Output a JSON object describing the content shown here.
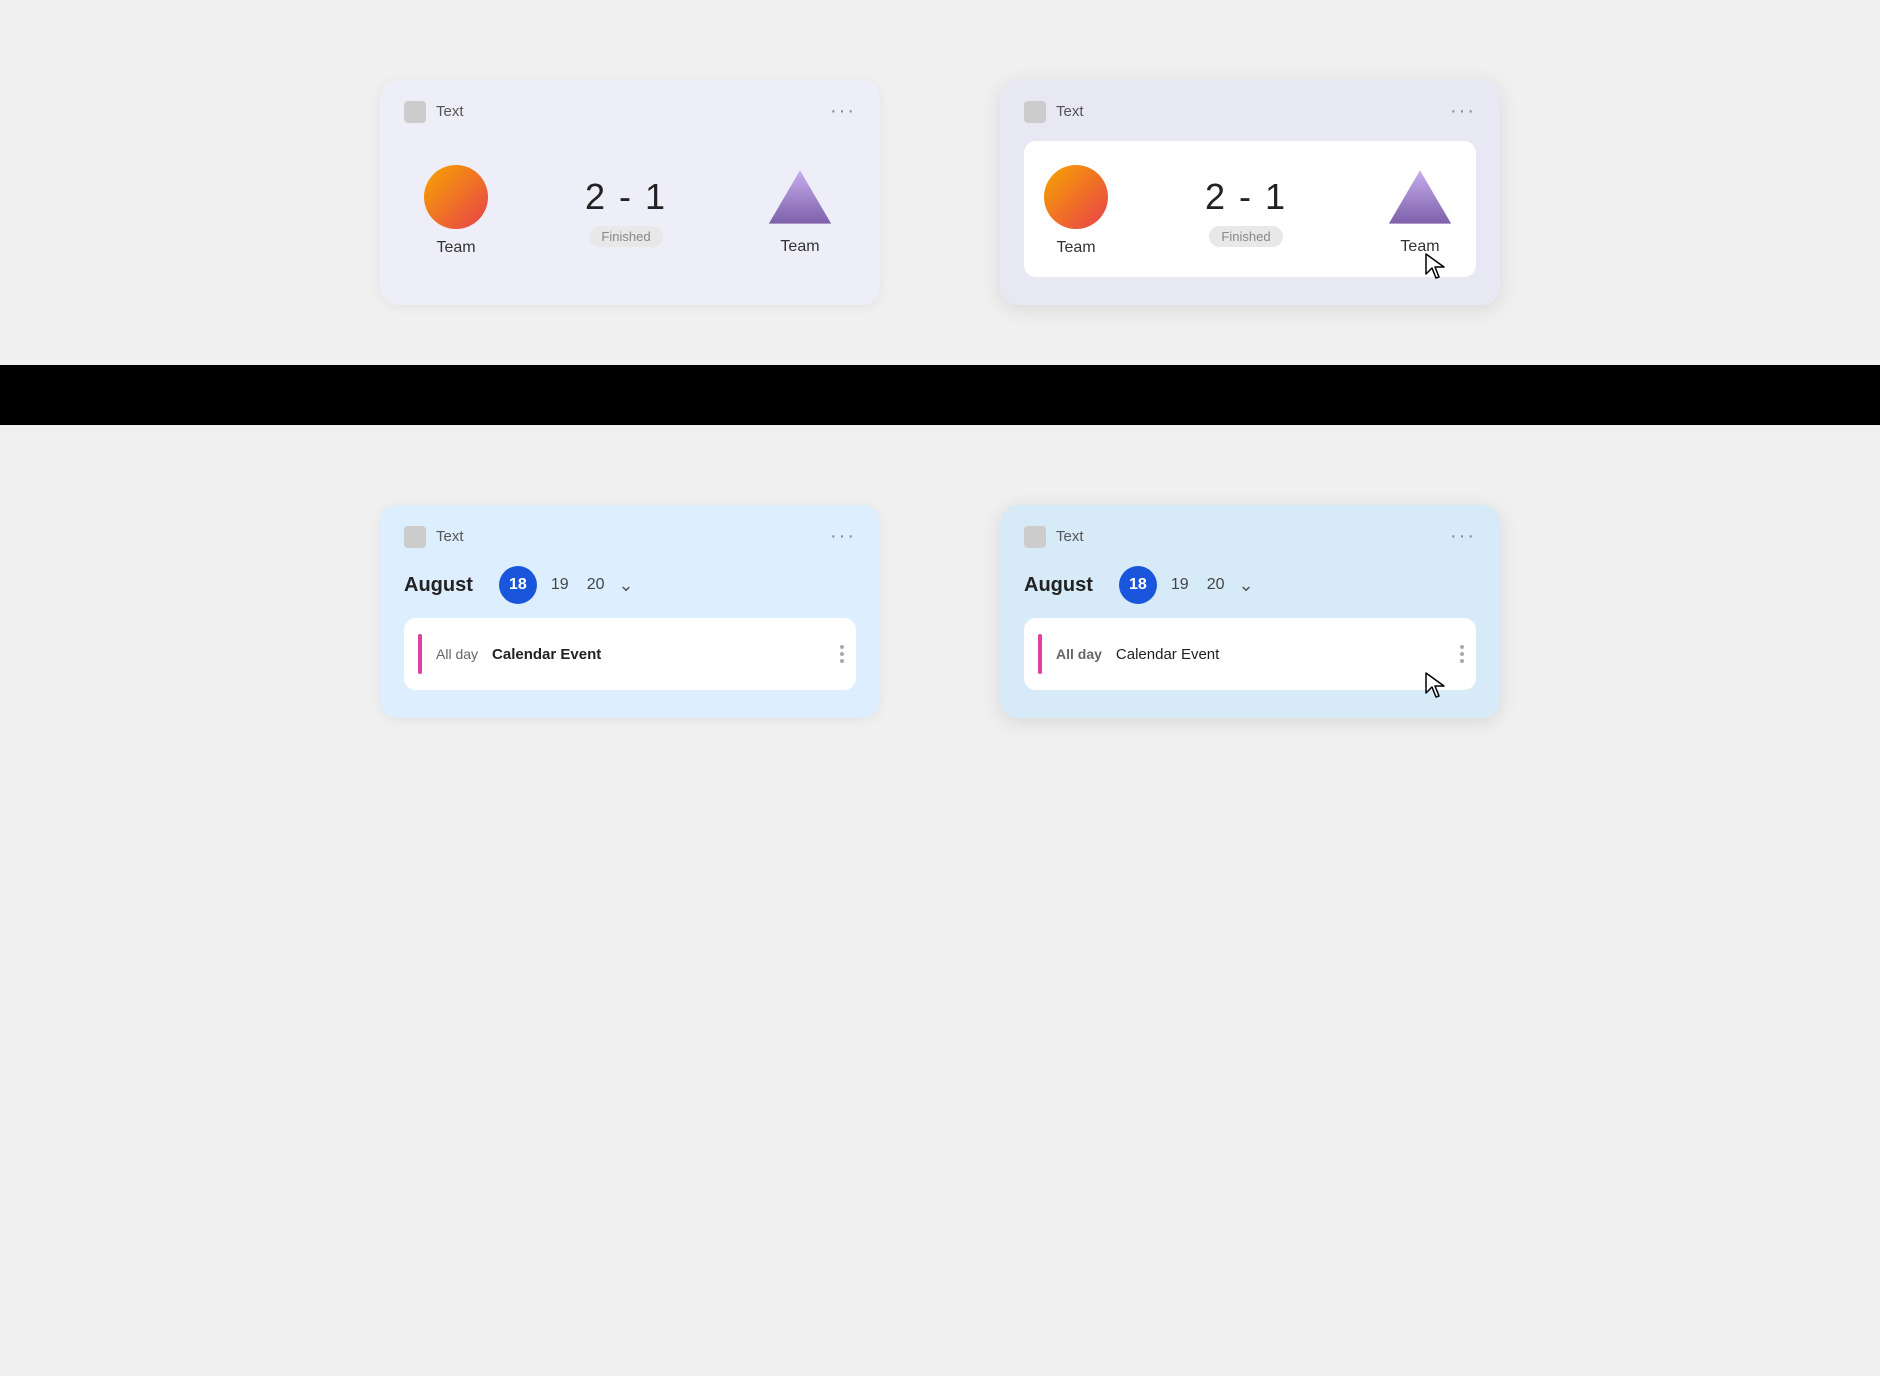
{
  "cards": {
    "sport_card_1": {
      "header_icon_label": "Text",
      "more_label": "···",
      "team1_name": "Team",
      "team2_name": "Team",
      "score": "2 - 1",
      "status": "Finished"
    },
    "sport_card_2": {
      "header_icon_label": "Text",
      "more_label": "···",
      "team1_name": "Team",
      "team2_name": "Team",
      "score": "2 - 1",
      "status": "Finished"
    },
    "cal_card_1": {
      "header_icon_label": "Text",
      "more_label": "···",
      "month": "August",
      "day_active": "18",
      "day2": "19",
      "day3": "20",
      "event_allday": "All day",
      "event_title": "Calendar Event"
    },
    "cal_card_2": {
      "header_icon_label": "Text",
      "more_label": "···",
      "month": "August",
      "day_active": "18",
      "day2": "19",
      "day3": "20",
      "event_allday": "All day",
      "event_title": "Calendar Event"
    }
  }
}
